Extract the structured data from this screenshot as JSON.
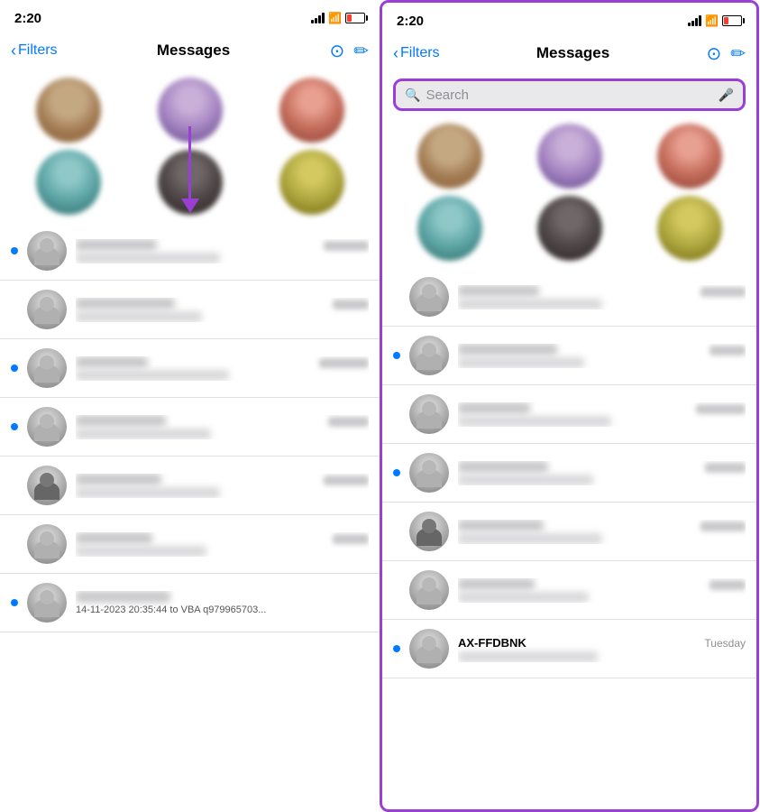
{
  "left_panel": {
    "status_bar": {
      "time": "2:20",
      "battery_num": "8"
    },
    "nav": {
      "back_label": "Filters",
      "title": "Messages",
      "btn_dots": "···",
      "btn_compose": "✏"
    },
    "pinned_contacts": [
      {
        "row": 0,
        "avatars": [
          "avatar-1",
          "avatar-2",
          "avatar-3"
        ]
      },
      {
        "row": 1,
        "avatars": [
          "avatar-4",
          "avatar-5",
          "avatar-6"
        ]
      }
    ],
    "message_items": [
      {
        "unread": true,
        "name_width": 90,
        "time_width": 50,
        "preview_width": 160,
        "dark": false
      },
      {
        "unread": false,
        "name_width": 110,
        "time_width": 40,
        "preview_width": 140,
        "dark": false
      },
      {
        "unread": true,
        "name_width": 80,
        "time_width": 55,
        "preview_width": 170,
        "dark": false
      },
      {
        "unread": true,
        "name_width": 100,
        "time_width": 45,
        "preview_width": 150,
        "dark": false
      },
      {
        "unread": false,
        "name_width": 95,
        "time_width": 50,
        "preview_width": 160,
        "dark": true
      },
      {
        "unread": false,
        "name_width": 85,
        "time_width": 40,
        "preview_width": 145,
        "dark": false
      },
      {
        "unread": true,
        "name_width": 105,
        "time_width": 48,
        "preview_width": 155,
        "dark": false
      }
    ],
    "bottom_timestamp": "14-11-2023 20:35:44 to VBA q979965703..."
  },
  "right_panel": {
    "status_bar": {
      "time": "2:20",
      "battery_num": "8"
    },
    "nav": {
      "back_label": "Filters",
      "title": "Messages",
      "btn_dots": "···",
      "btn_compose": "✏"
    },
    "search_bar": {
      "placeholder": "Search",
      "mic_icon": "🎤"
    },
    "pinned_contacts": [
      {
        "row": 0,
        "avatars": [
          "avatar-1",
          "avatar-2",
          "avatar-3"
        ]
      },
      {
        "row": 1,
        "avatars": [
          "avatar-4",
          "avatar-5",
          "avatar-6"
        ]
      }
    ],
    "message_items": [
      {
        "unread": false,
        "name_width": 90,
        "time_width": 50,
        "preview_width": 160,
        "dark": false
      },
      {
        "unread": true,
        "name_width": 110,
        "time_width": 40,
        "preview_width": 140,
        "dark": false
      },
      {
        "unread": false,
        "name_width": 80,
        "time_width": 55,
        "preview_width": 170,
        "dark": false
      },
      {
        "unread": true,
        "name_width": 100,
        "time_width": 45,
        "preview_width": 150,
        "dark": false
      },
      {
        "unread": false,
        "name_width": 95,
        "time_width": 50,
        "preview_width": 160,
        "dark": true
      },
      {
        "unread": false,
        "name_width": 85,
        "time_width": 40,
        "preview_width": 145,
        "dark": false
      },
      {
        "unread": true,
        "name_width": 105,
        "time_width": 48,
        "preview_width": 155,
        "dark": false
      }
    ],
    "bottom_label": "AX-FFDBNK",
    "bottom_time": "Tuesday"
  },
  "accent_color": "#9b3fd4",
  "unread_color": "#007aff"
}
